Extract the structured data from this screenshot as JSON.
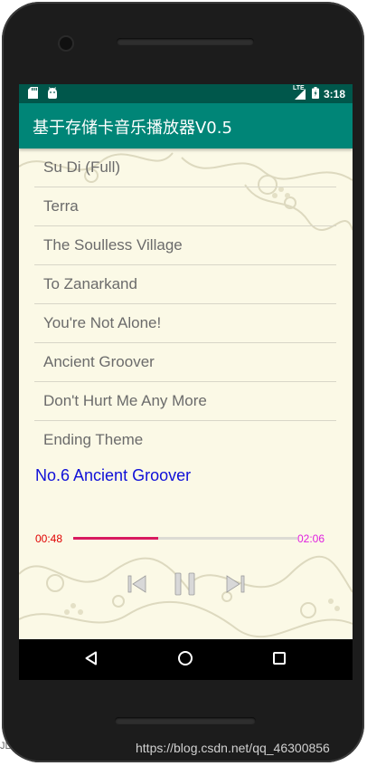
{
  "status_bar": {
    "time": "3:18",
    "network_label": "LTE",
    "icons": [
      "sd-card-icon",
      "android-icon",
      "signal-icon",
      "battery-icon"
    ]
  },
  "app_bar": {
    "title": "基于存储卡音乐播放器V0.5"
  },
  "songs": [
    {
      "title": "Su Di (Full)"
    },
    {
      "title": "Terra"
    },
    {
      "title": "The Soulless Village"
    },
    {
      "title": "To Zanarkand"
    },
    {
      "title": "You're Not Alone!"
    },
    {
      "title": "Ancient Groover"
    },
    {
      "title": "Don't Hurt Me Any More"
    },
    {
      "title": "Ending Theme"
    }
  ],
  "player": {
    "now_playing": "No.6 Ancient Groover",
    "current_time": "00:48",
    "total_time": "02:06",
    "progress_fraction": 0.381,
    "controls": [
      "skip-previous-icon",
      "pause-icon",
      "skip-next-icon"
    ]
  },
  "nav": {
    "buttons": [
      "back-icon",
      "home-icon",
      "recents-icon"
    ]
  },
  "watermark": "https://blog.csdn.net/qq_46300856",
  "side_text": "JL",
  "colors": {
    "status_bar": "#00574b",
    "app_bar": "#008577",
    "background": "#fbf9e6",
    "now_playing": "#1010d8",
    "current_time": "#e00000",
    "total_time": "#e020e0",
    "seek_fill": "#d81b60"
  }
}
